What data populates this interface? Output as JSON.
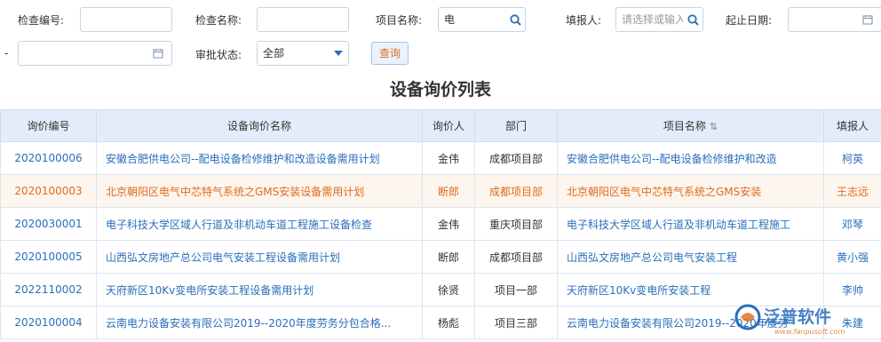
{
  "filters": {
    "check_no_label": "检查编号:",
    "check_name_label": "检查名称:",
    "project_name_label": "项目名称:",
    "project_name_value": "电",
    "reporter_label": "填报人:",
    "reporter_placeholder": "请选择或输入",
    "date_label": "起止日期:",
    "date_sep": "-",
    "approval_label": "审批状态:",
    "approval_value": "全部",
    "query_button": "查询"
  },
  "title": "设备询价列表",
  "table": {
    "headers": [
      "询价编号",
      "设备询价名称",
      "询价人",
      "部门",
      "项目名称",
      "填报人"
    ],
    "rows": [
      [
        "2020100006",
        "安徽合肥供电公司--配电设备检修维护和改造设备需用计划",
        "金伟",
        "成都项目部",
        "安徽合肥供电公司--配电设备检修维护和改造",
        "柯英"
      ],
      [
        "2020100003",
        "北京朝阳区电气中芯特气系统之GMS安装设备需用计划",
        "断郎",
        "成都项目部",
        "北京朝阳区电气中芯特气系统之GMS安装",
        "王志远"
      ],
      [
        "2020030001",
        "电子科技大学区域人行道及非机动车道工程施工设备检查",
        "金伟",
        "重庆项目部",
        "电子科技大学区域人行道及非机动车道工程施工",
        "邓琴"
      ],
      [
        "2020100005",
        "山西弘文房地产总公司电气安装工程设备需用计划",
        "断郎",
        "成都项目部",
        "山西弘文房地产总公司电气安装工程",
        "黄小强"
      ],
      [
        "2022110002",
        "天府新区10Kv变电所安装工程设备需用计划",
        "徐贤",
        "项目一部",
        "天府新区10Kv变电所安装工程",
        "李帅"
      ],
      [
        "2020100004",
        "云南电力设备安装有限公司2019--2020年度劳务分包合格...",
        "杨彪",
        "项目三部",
        "云南电力设备安装有限公司2019--2020年度劳",
        "朱建"
      ]
    ]
  },
  "watermark": {
    "text": "泛普软件",
    "url": "www.fanpusoft.com"
  }
}
